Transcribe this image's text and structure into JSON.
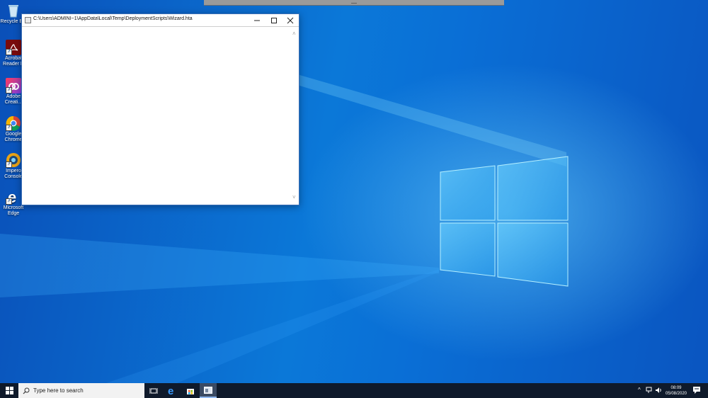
{
  "desktop": {
    "icons": [
      {
        "name": "recycle-bin",
        "label": "Recycle Bin"
      },
      {
        "name": "acrobat-reader",
        "label": "Acrobat\nReader D"
      },
      {
        "name": "adobe-creative-cloud",
        "label": "Adobe\nCreati..."
      },
      {
        "name": "google-chrome",
        "label": "Google\nChrome"
      },
      {
        "name": "ivanti-console",
        "label": "Impero\nConsole"
      },
      {
        "name": "microsoft-edge",
        "label": "Microsoft\nEdge"
      }
    ]
  },
  "window": {
    "title": "C:\\Users\\ADMINI~1\\AppData\\Local\\Temp\\DeploymentScripts\\Wizard.hta",
    "minimize_glyph": "—",
    "maximize_glyph": "☐",
    "close_glyph": "✕",
    "scroll_up": "˄",
    "scroll_down": "˅"
  },
  "taskbar": {
    "search_placeholder": "Type here to search",
    "time": "08:09",
    "date": "05/08/2020",
    "tray_chevron": "^",
    "accent_color": "#0078d7"
  }
}
